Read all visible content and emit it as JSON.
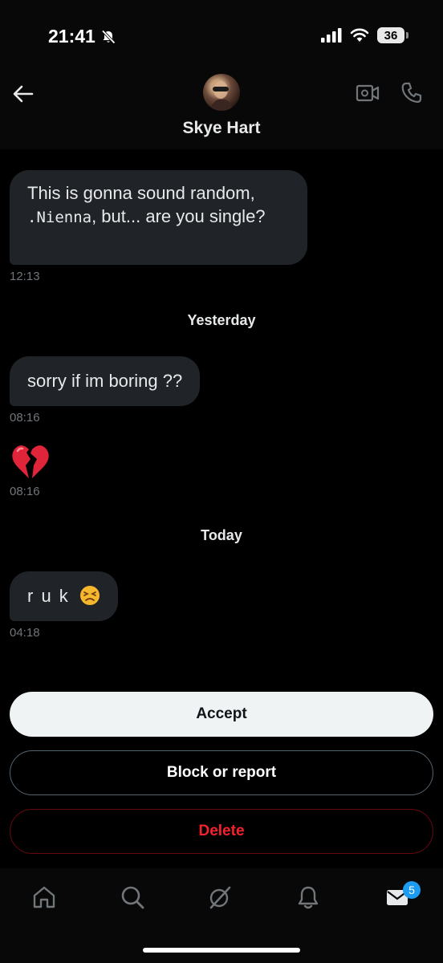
{
  "status_bar": {
    "time": "21:41",
    "battery": "36",
    "icons": [
      "bell-slash-icon",
      "signal-icon",
      "wifi-icon",
      "battery-icon"
    ]
  },
  "header": {
    "name": "Skye Hart",
    "icons": [
      "back-arrow-icon",
      "avatar",
      "video-call-icon",
      "phone-call-icon"
    ]
  },
  "messages": [
    {
      "text_before": "This is gonna sound random, ",
      "text_mono": ".Nienna",
      "text_after": ", but... are you single?",
      "time": "12:13"
    },
    {
      "separator": "Yesterday"
    },
    {
      "text": "sorry if im boring ??",
      "time": "08:16"
    },
    {
      "emoji": "broken-heart-emoji",
      "time": "08:16"
    },
    {
      "separator": "Today"
    },
    {
      "text": "r u k",
      "emoji": "persevering-face-emoji",
      "time": "04:18"
    }
  ],
  "actions": {
    "accept": "Accept",
    "block": "Block or report",
    "delete": "Delete"
  },
  "bottom_nav": {
    "items": [
      "home-icon",
      "search-icon",
      "grok-icon",
      "notifications-icon",
      "messages-icon"
    ],
    "messages_badge": "5"
  },
  "colors": {
    "background": "#000000",
    "bubble": "#202327",
    "muted": "#71767b",
    "accept_bg": "#eff3f4",
    "delete": "#f4212e",
    "badge": "#1d9bf0"
  }
}
